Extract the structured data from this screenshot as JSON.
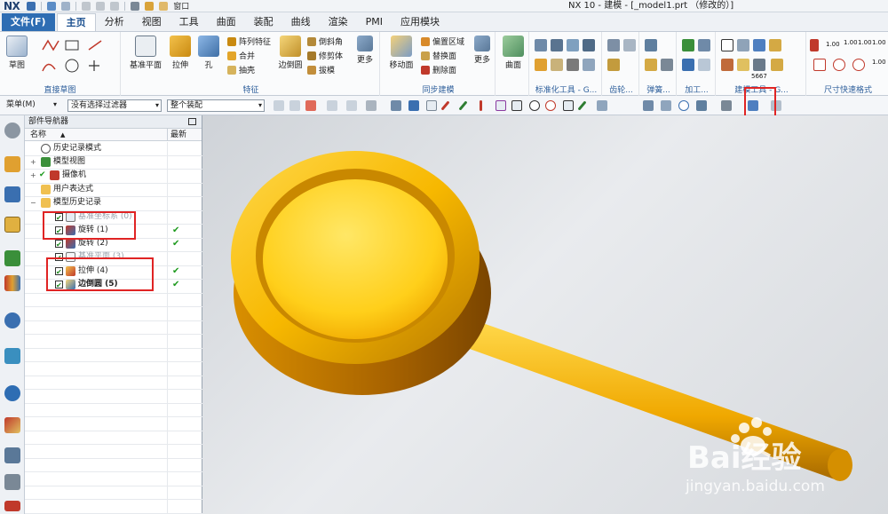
{
  "app": {
    "logo": "NX",
    "window_menu_label": "窗口",
    "title": "NX 10 - 建模 - [_model1.prt （修改的）]"
  },
  "menu_tabs": [
    {
      "label": "文件(F)"
    },
    {
      "label": "主页"
    },
    {
      "label": "分析"
    },
    {
      "label": "视图"
    },
    {
      "label": "工具"
    },
    {
      "label": "曲面"
    },
    {
      "label": "装配"
    },
    {
      "label": "曲线"
    },
    {
      "label": "渲染"
    },
    {
      "label": "PMI"
    },
    {
      "label": "应用模块"
    }
  ],
  "ribbon": {
    "sketch_group": {
      "label": "直接草图",
      "sketch_btn": "草图"
    },
    "feature_group": {
      "label": "特征",
      "datum_plane": "基准平面",
      "extrude": "拉伸",
      "hole": "孔",
      "pattern": "阵列特征",
      "unite": "合并",
      "shell": "抽壳",
      "edge_blend": "边倒圆",
      "chamfer": "倒斜角",
      "trim_body": "修剪体",
      "draft": "拔模",
      "more": "更多"
    },
    "sync_group": {
      "label": "同步建模",
      "move_face": "移动面",
      "offset_region": "偏置区域",
      "replace_face": "替换面",
      "delete_face": "删除面",
      "more": "更多"
    },
    "surface_btn": "曲面",
    "std_tools_label": "标准化工具 - G...",
    "gear_label": "齿轮...",
    "spring_label": "弹簧...",
    "process_label": "加工...",
    "modeling_tools_label": "建模工具 - G...",
    "dim_label": "尺寸快速格式",
    "tiny_labels": [
      "1.00",
      "1.00",
      "1.00",
      "1.00",
      "1.00",
      "5667"
    ]
  },
  "selection_bar": {
    "menu_label": "菜单(M)",
    "filter_value": "没有选择过滤器",
    "scope_value": "整个装配"
  },
  "navigator": {
    "title": "部件导航器",
    "col_name": "名称",
    "col_latest": "最新",
    "rows": [
      {
        "label": "历史记录模式"
      },
      {
        "label": "模型视图"
      },
      {
        "label": "摄像机"
      },
      {
        "label": "用户表达式"
      },
      {
        "label": "模型历史记录"
      },
      {
        "label": "基准坐标系 (0)"
      },
      {
        "label": "旋转 (1)"
      },
      {
        "label": "旋转 (2)"
      },
      {
        "label": "基准平面 (3)"
      },
      {
        "label": "拉伸 (4)"
      },
      {
        "label": "边倒圆 (5)"
      }
    ]
  },
  "watermark": {
    "brand": "Bai经验",
    "url": "jingyan.baidu.com"
  },
  "colors": {
    "accent_blue": "#2e6db3",
    "model_yellow": "#f7b800",
    "highlight_red": "#e02424",
    "check_green": "#1e9a1e"
  }
}
